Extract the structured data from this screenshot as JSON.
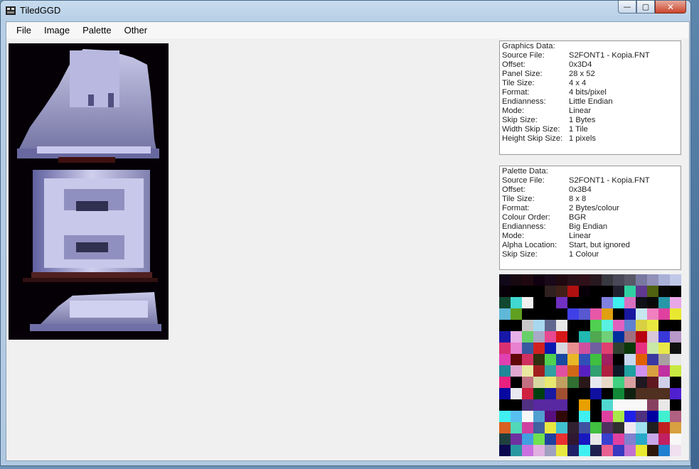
{
  "window": {
    "title": "TiledGGD",
    "minimize": "—",
    "maximize": "▢",
    "close": "✕"
  },
  "menu": [
    "File",
    "Image",
    "Palette",
    "Other"
  ],
  "graphics": {
    "header": "Graphics Data:",
    "rows": [
      {
        "k": "Source File:",
        "v": "S2FONT1 - Kopia.FNT"
      },
      {
        "k": "Offset:",
        "v": "0x3D4"
      },
      {
        "k": "Panel Size:",
        "v": "28 x 52"
      },
      {
        "k": "Tile Size:",
        "v": "4 x 4"
      },
      {
        "k": "Format:",
        "v": "4 bits/pixel"
      },
      {
        "k": "Endianness:",
        "v": "Little Endian"
      },
      {
        "k": "Mode:",
        "v": "Linear"
      },
      {
        "k": "Skip Size:",
        "v": "1 Bytes"
      },
      {
        "k": "Width Skip Size:",
        "v": "1 Tile"
      },
      {
        "k": "Height Skip Size:",
        "v": "1 pixels"
      }
    ]
  },
  "palette_info": {
    "header": "Palette Data:",
    "rows": [
      {
        "k": "Source File:",
        "v": "S2FONT1 - Kopia.FNT"
      },
      {
        "k": "Offset:",
        "v": "0x3B4"
      },
      {
        "k": "Tile Size:",
        "v": "8 x 8"
      },
      {
        "k": "Format:",
        "v": "2 Bytes/colour"
      },
      {
        "k": "Colour Order:",
        "v": "BGR"
      },
      {
        "k": "Endianness:",
        "v": "Big Endian"
      },
      {
        "k": "Mode:",
        "v": "Linear"
      },
      {
        "k": "Alpha Location:",
        "v": "Start, but ignored"
      },
      {
        "k": "Skip Size:",
        "v": "1 Colour"
      }
    ]
  },
  "palette_colors": [
    "#100818",
    "#180810",
    "#200810",
    "#100010",
    "#180818",
    "#200810",
    "#281018",
    "#301018",
    "#281820",
    "#383840",
    "#484858",
    "#585868",
    "#7878a0",
    "#9090b8",
    "#a8b0d8",
    "#c0c8e8",
    "#080008",
    "#000000",
    "#000000",
    "#000000",
    "#302020",
    "#402018",
    "#b01010",
    "#080008",
    "#000000",
    "#000000",
    "#202030",
    "#30d0a0",
    "#603890",
    "#506010",
    "#080808",
    "#000000",
    "#104830",
    "#40d8d0",
    "#f0f0f0",
    "#000000",
    "#000000",
    "#7030c0",
    "#000000",
    "#000000",
    "#000000",
    "#8080e0",
    "#40f0f0",
    "#d870c0",
    "#101018",
    "#080808",
    "#2898a8",
    "#e8a8e8",
    "#60b8d8",
    "#60a020",
    "#000000",
    "#000000",
    "#000000",
    "#000000",
    "#4040e8",
    "#5858d0",
    "#e858a8",
    "#e0a010",
    "#000000",
    "#1818a0",
    "#c8e8f0",
    "#f080c0",
    "#e040a0",
    "#e8e830",
    "#000000",
    "#000000",
    "#c8c8c8",
    "#a8d8f0",
    "#606890",
    "#e8e8e8",
    "#000000",
    "#000000",
    "#50d050",
    "#58f0e0",
    "#e060c0",
    "#6080d0",
    "#d8d040",
    "#e8e840",
    "#000000",
    "#000000",
    "#1818a8",
    "#e8b0e8",
    "#68d068",
    "#a8a8c8",
    "#e84890",
    "#d81818",
    "#000000",
    "#20b8b0",
    "#50a850",
    "#70d078",
    "#0030a0",
    "#a07080",
    "#b80010",
    "#d8c8d8",
    "#3838d8",
    "#b898c8",
    "#d83070",
    "#e880d0",
    "#3858a0",
    "#d02020",
    "#0818b0",
    "#d8d8e0",
    "#e89090",
    "#d050a0",
    "#7060a0",
    "#e04070",
    "#304030",
    "#0a3808",
    "#e83080",
    "#c8e8a8",
    "#e8e848",
    "#101010",
    "#e040b0",
    "#600808",
    "#d03060",
    "#303010",
    "#50d050",
    "#1848a0",
    "#e8b828",
    "#3050b8",
    "#40c040",
    "#a02060",
    "#000000",
    "#c8d8f0",
    "#e06000",
    "#3838a0",
    "#a8a0a0",
    "#e8e8e8",
    "#208898",
    "#e0a8d0",
    "#e8e8a0",
    "#a02020",
    "#30a0a0",
    "#e050a0",
    "#d06818",
    "#5820c0",
    "#30a070",
    "#b02040",
    "#101828",
    "#20a0a0",
    "#d090f0",
    "#d8a040",
    "#c030a0",
    "#c8e840",
    "#e82080",
    "#000000",
    "#c07080",
    "#d8d8a0",
    "#e8e870",
    "#c0a060",
    "#307030",
    "#2a1818",
    "#e8e8f0",
    "#e8d8c8",
    "#40d080",
    "#d8a0a0",
    "#201820",
    "#601820",
    "#d0d0e8",
    "#000000",
    "#0808a0",
    "#e8e8f0",
    "#d02040",
    "#004010",
    "#1818a0",
    "#a05030",
    "#000000",
    "#000000",
    "#1010a0",
    "#000000",
    "#108838",
    "#102010",
    "#503020",
    "#503020",
    "#503020",
    "#5020d0",
    "#000000",
    "#000000",
    "#503080",
    "#5828a0",
    "#5828a0",
    "#5828a0",
    "#000000",
    "#e8a000",
    "#000000",
    "#50d8d0",
    "#f8f8f8",
    "#f8f8f8",
    "#f8f8f8",
    "#884060",
    "#e8e8e8",
    "#000000",
    "#40f0f0",
    "#58c0f0",
    "#f8f8f8",
    "#50a0d0",
    "#581080",
    "#300808",
    "#000000",
    "#40f0f0",
    "#000000",
    "#e040a0",
    "#a8e848",
    "#2020e8",
    "#503080",
    "#0000a0",
    "#40f0d0",
    "#b06080",
    "#d86020",
    "#50d8b8",
    "#d040a0",
    "#4060a0",
    "#e8e840",
    "#40c0d0",
    "#302030",
    "#4050a0",
    "#40c040",
    "#503060",
    "#303030",
    "#f0e8f0",
    "#a0e0f0",
    "#202020",
    "#c02020",
    "#d8a040",
    "#204040",
    "#7030a0",
    "#40a0e0",
    "#70e050",
    "#2040a0",
    "#e83030",
    "#301830",
    "#1818c0",
    "#e8e8e8",
    "#3840d0",
    "#e040a0",
    "#8080d0",
    "#28a8c8",
    "#c8a8e8",
    "#c02060",
    "#f8f8f8",
    "#0c0850",
    "#2898a0",
    "#c870e0",
    "#e0b0e0",
    "#a0a0c0",
    "#e8e840",
    "#202068",
    "#40f0f0",
    "#202050",
    "#e86090",
    "#3838c0",
    "#c070d0",
    "#e8e830",
    "#301808",
    "#2080d0",
    "#f0e0f0"
  ]
}
